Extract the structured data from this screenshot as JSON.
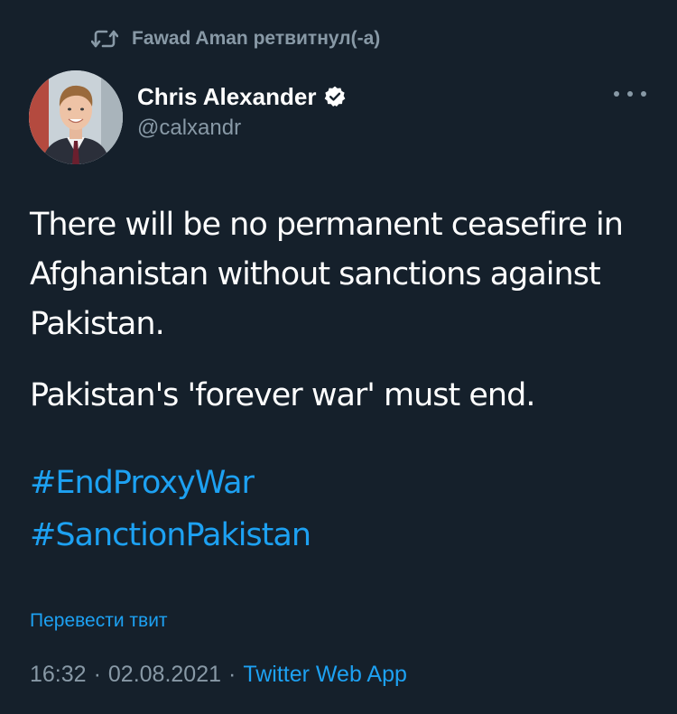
{
  "retweet": {
    "label": "Fawad Aman ретвитнул(-а)",
    "icon": "retweet-icon"
  },
  "author": {
    "name": "Chris Alexander",
    "handle": "@calxandr",
    "verified_icon": "verified-badge-icon",
    "avatar_icon": "avatar"
  },
  "tweet": {
    "paragraph1": "There will be no permanent ceasefire in Afghanistan without sanctions against Pakistan.",
    "paragraph2": "Pakistan's 'forever war' must end.",
    "hashtags": [
      "#EndProxyWar",
      "#SanctionPakistan"
    ]
  },
  "translate_label": "Перевести твит",
  "meta": {
    "time": "16:32",
    "date": "02.08.2021",
    "separator": "·",
    "source": "Twitter Web App"
  },
  "colors": {
    "background": "#15202b",
    "text": "#ffffff",
    "muted": "#8899a6",
    "accent": "#1da1f2"
  }
}
